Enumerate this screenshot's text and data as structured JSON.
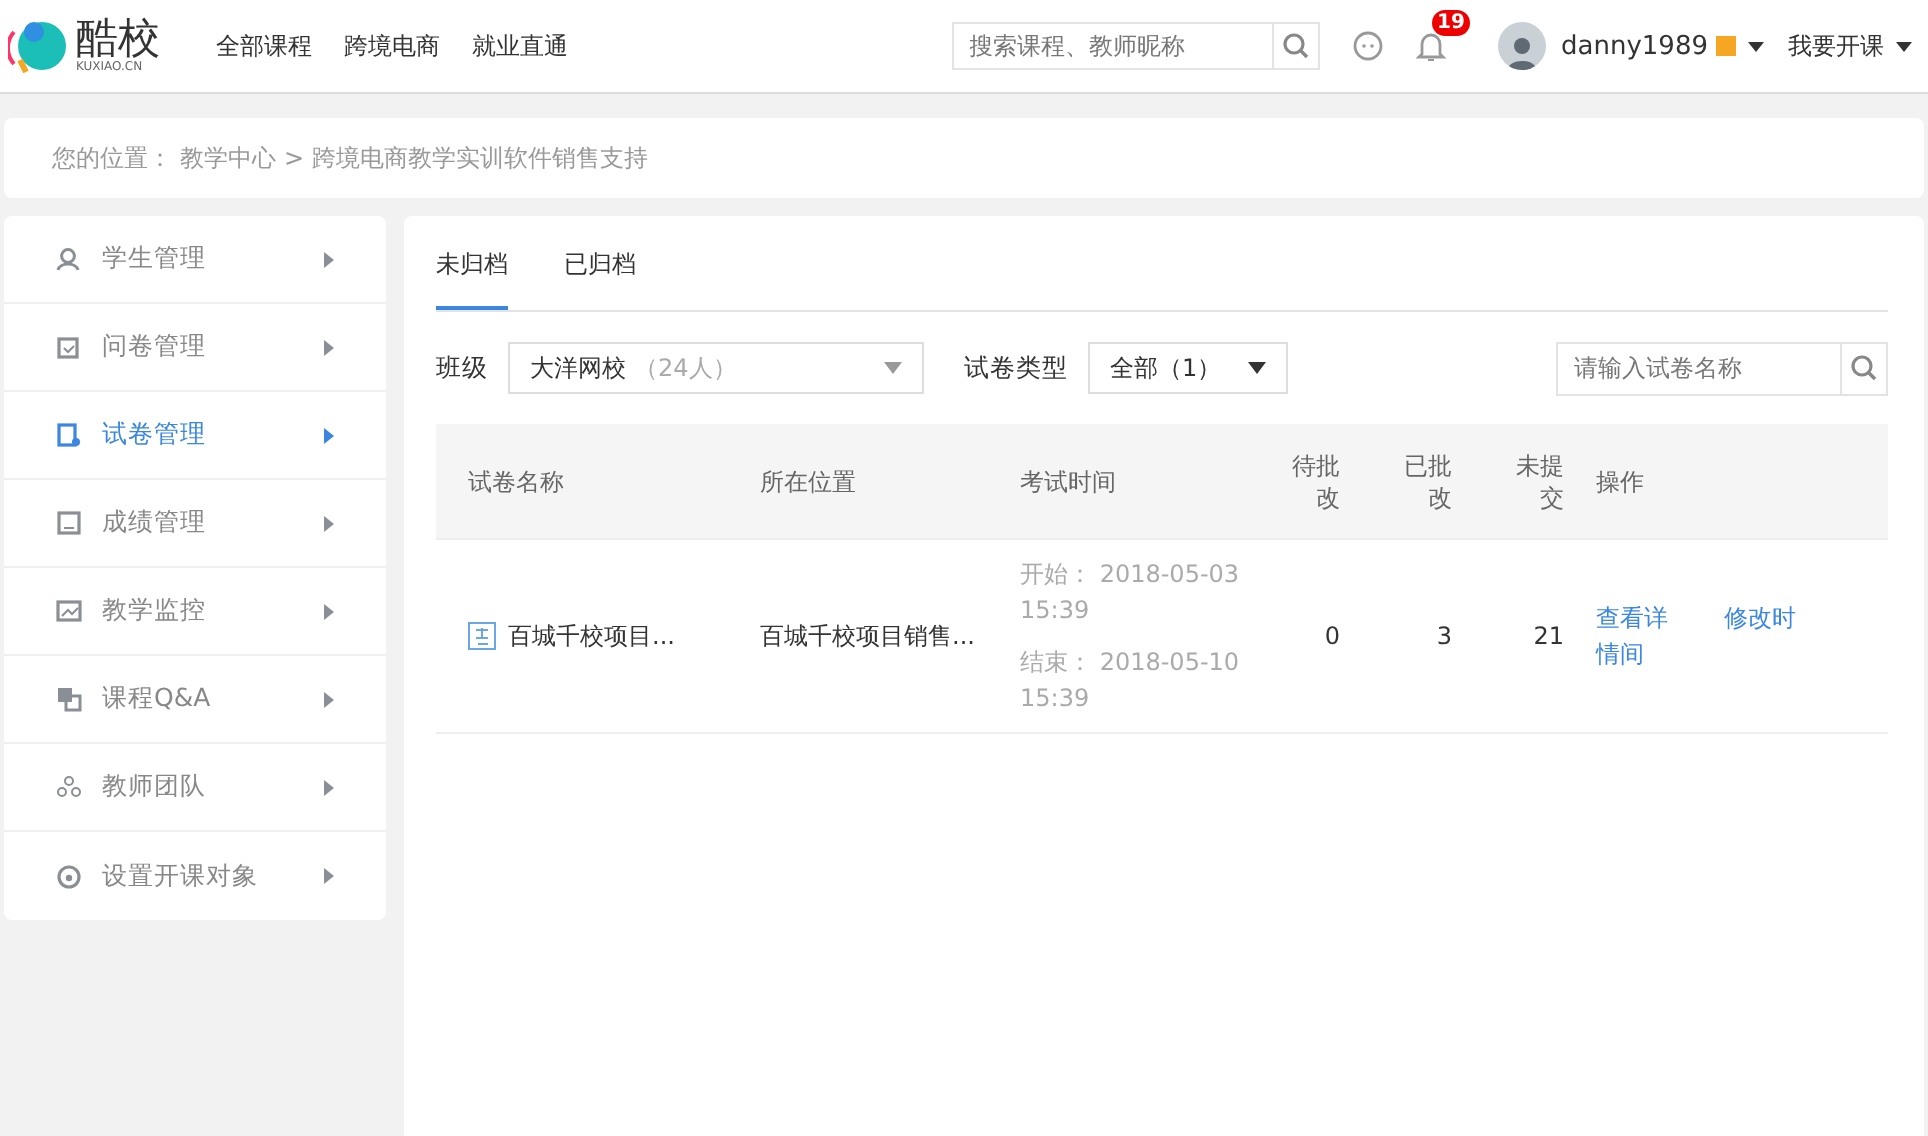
{
  "header": {
    "logo_text": "酷校",
    "logo_sub": "KUXIAO.CN",
    "nav": [
      "全部课程",
      "跨境电商",
      "就业直通"
    ],
    "search": {
      "placeholder": "搜索课程、教师昵称"
    },
    "notifications": "19",
    "user": "danny1989",
    "vip": true,
    "open_course": "我要开课"
  },
  "breadcrumb": {
    "label": "您的位置：",
    "path": [
      "教学中心",
      "跨境电商教学实训软件销售支持"
    ],
    "separator": ">"
  },
  "sidebar": {
    "items": [
      {
        "label": "学生管理",
        "selected": false
      },
      {
        "label": "问卷管理",
        "selected": false
      },
      {
        "label": "试卷管理",
        "selected": true
      },
      {
        "label": "成绩管理",
        "selected": false
      },
      {
        "label": "教学监控",
        "selected": false
      },
      {
        "label": "课程Q&A",
        "selected": false
      },
      {
        "label": "教师团队",
        "selected": false
      },
      {
        "label": "设置开课对象",
        "selected": false
      }
    ]
  },
  "tabs": [
    {
      "label": "未归档",
      "selected": true
    },
    {
      "label": "已归档",
      "selected": false
    }
  ],
  "filters": {
    "class_label": "班级",
    "class_value": "大洋网校",
    "class_count": "（24人）",
    "type_label": "试卷类型",
    "type_value": "全部（1）",
    "search": {
      "placeholder": "请输入试卷名称"
    }
  },
  "table": {
    "columns": [
      "试卷名称",
      "所在位置",
      "考试时间",
      "待批改",
      "已批改",
      "未提交",
      "操作"
    ],
    "rows": [
      {
        "name": "百城千校项目...",
        "location": "百城千校项目销售...",
        "start": "开始： 2018-05-03 15:39",
        "end": "结束： 2018-05-10 15:39",
        "pending": "0",
        "graded": "3",
        "unsubmitted": "21",
        "actions": [
          "查看详情间",
          "修改时"
        ]
      }
    ]
  }
}
